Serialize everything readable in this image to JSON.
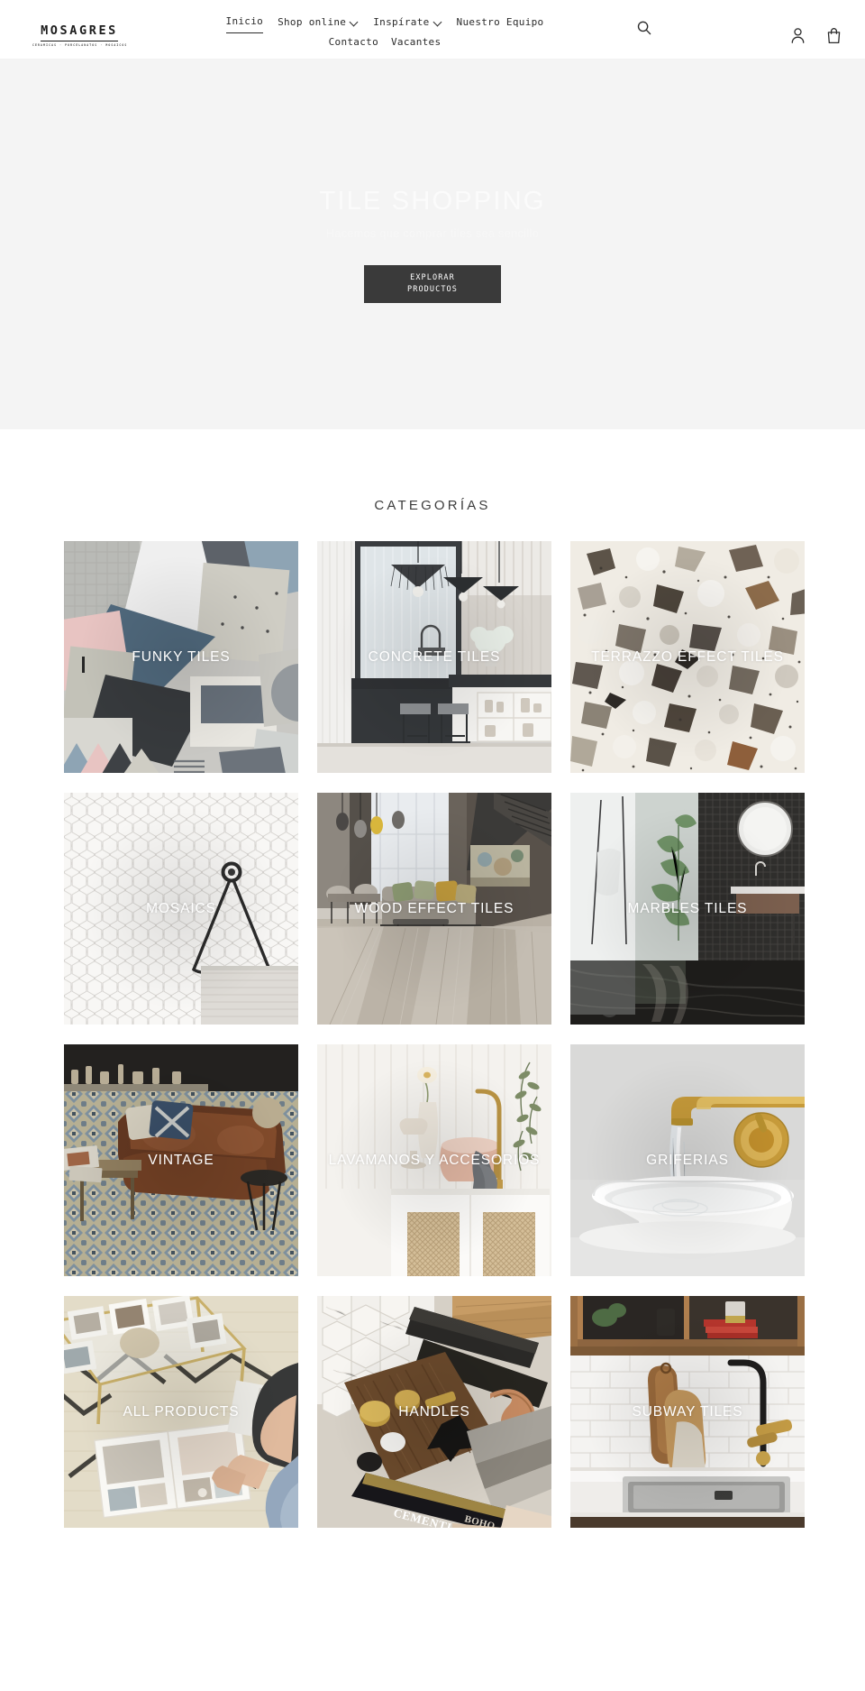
{
  "header": {
    "logo": {
      "word": "MOSAGRES",
      "tagline": "CERAMICAS · PORCELANATOS · MOSAICOS"
    },
    "nav_row1": [
      {
        "label": "Inicio",
        "active": true,
        "caret": false
      },
      {
        "label": "Shop online",
        "active": false,
        "caret": true
      },
      {
        "label": "Inspírate",
        "active": false,
        "caret": true
      },
      {
        "label": "Nuestro Equipo",
        "active": false,
        "caret": false
      }
    ],
    "nav_row2": [
      {
        "label": "Contacto",
        "active": false,
        "caret": false
      },
      {
        "label": "Vacantes",
        "active": false,
        "caret": false
      }
    ],
    "icons": {
      "search": "search-icon",
      "account": "account-icon",
      "cart": "cart-icon"
    }
  },
  "hero": {
    "title": "TILE SHOPPING",
    "subtitle": "Hacemos que comprar tiles sea sencillo",
    "cta_line1": "EXPLORAR",
    "cta_line2": "PRODUCTOS",
    "background_color": "#f4f4f4",
    "cta_color": "#3a3a3a"
  },
  "categories": {
    "heading": "CATEGORÍAS",
    "items": [
      {
        "label": "FUNKY TILES",
        "art": "funky"
      },
      {
        "label": "CONCRETE TILES",
        "art": "concrete"
      },
      {
        "label": "TERRAZZO EFFECT TILES",
        "art": "terrazzo"
      },
      {
        "label": "MOSAICS",
        "art": "mosaics"
      },
      {
        "label": "WOOD EFFECT TILES",
        "art": "wood"
      },
      {
        "label": "MARBLES TILES",
        "art": "marble"
      },
      {
        "label": "VINTAGE",
        "art": "vintage"
      },
      {
        "label": "LAVAMANOS Y ACCESORIOS",
        "art": "lavamanos"
      },
      {
        "label": "GRIFERIAS",
        "art": "griferias"
      },
      {
        "label": "ALL PRODUCTS",
        "art": "allprod"
      },
      {
        "label": "HANDLES",
        "art": "handles"
      },
      {
        "label": "SUBWAY TILES",
        "art": "subway"
      }
    ],
    "overlay_text_color": "#ffffff"
  }
}
